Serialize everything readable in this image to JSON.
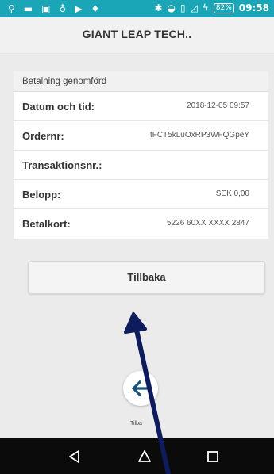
{
  "status_bar": {
    "battery_percent": "82%",
    "time": "09:58"
  },
  "app_bar": {
    "title": "GIANT LEAP TECH.."
  },
  "receipt": {
    "header": "Betalning genomförd",
    "rows": [
      {
        "label": "Datum och tid:",
        "value": "2018-12-05 09:57"
      },
      {
        "label": "Ordernr:",
        "value": "tFCT5kLuOxRP3WFQGpeY"
      },
      {
        "label": "Transaktionsnr.:",
        "value": ""
      },
      {
        "label": "Belopp:",
        "value": "SEK 0,00"
      },
      {
        "label": "Betalkort:",
        "value": "5226 60XX XXXX 2847"
      }
    ]
  },
  "back_button": {
    "label": "Tillbaka"
  },
  "fab": {
    "label": "Tilba"
  },
  "colors": {
    "status_bar": "#1aa6b7",
    "fab_arrow": "#1a5277",
    "annotation_arrow": "#0e1b5c"
  }
}
